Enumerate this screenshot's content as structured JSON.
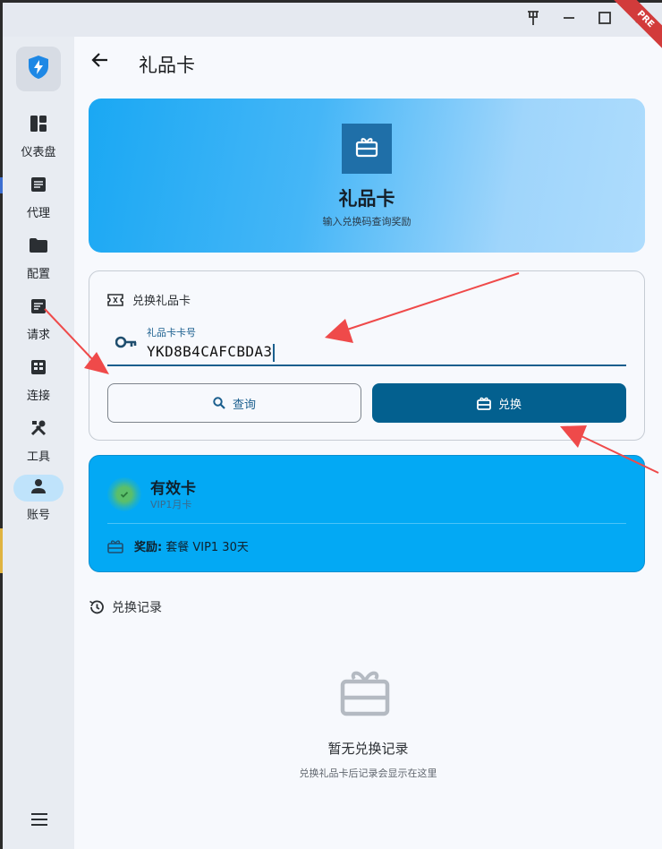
{
  "window": {
    "pin_icon": "pin-icon",
    "minimize_icon": "minimize-icon",
    "maximize_icon": "maximize-icon",
    "close_icon": "close-icon",
    "ribbon": "PRE"
  },
  "sidebar": {
    "logo_icon": "shield-bolt-icon",
    "items": [
      {
        "label": "仪表盘",
        "icon": "dashboard-icon"
      },
      {
        "label": "代理",
        "icon": "article-icon"
      },
      {
        "label": "配置",
        "icon": "folder-icon"
      },
      {
        "label": "请求",
        "icon": "request-icon"
      },
      {
        "label": "连接",
        "icon": "connections-icon"
      },
      {
        "label": "工具",
        "icon": "tools-icon"
      },
      {
        "label": "账号",
        "icon": "person-icon",
        "active": true
      }
    ],
    "menu_icon": "menu-icon"
  },
  "header": {
    "back_icon": "back-arrow-icon",
    "title": "礼品卡"
  },
  "hero": {
    "icon": "gift-card-icon",
    "title": "礼品卡",
    "subtitle": "输入兑换码查询奖励"
  },
  "redeem": {
    "heading": "兑换礼品卡",
    "field_label": "礼品卡卡号",
    "field_value": "YKD8B4CAFCBDA3",
    "query_label": "查询",
    "redeem_label": "兑换"
  },
  "result": {
    "status": "有效卡",
    "card_type": "VIP1月卡",
    "reward_prefix": "奖励:",
    "reward_text": "套餐 VIP1 30天"
  },
  "history": {
    "heading": "兑换记录",
    "empty_title": "暂无兑换记录",
    "empty_subtitle": "兑换礼品卡后记录会显示在这里"
  },
  "colors": {
    "primary": "#03608f",
    "accent_blue": "#03a9f4",
    "annotation_red": "#ef4a4a",
    "valid_green": "#5bbf6a"
  }
}
